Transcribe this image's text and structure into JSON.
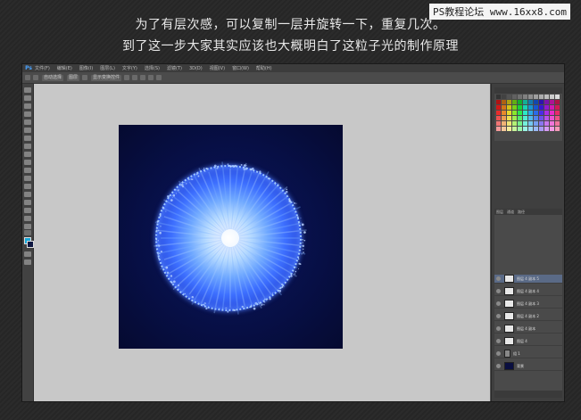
{
  "caption": {
    "line1": "为了有层次感，可以复制一层并旋转一下，重复几次。",
    "line2": "到了这一步大家其实应该也大概明白了这粒子光的制作原理"
  },
  "watermark": "PS教程论坛 www.16xx8.com",
  "photoshop": {
    "logo": "Ps",
    "menu": [
      "文件(F)",
      "编辑(E)",
      "图像(I)",
      "图层(L)",
      "文字(Y)",
      "选择(S)",
      "滤镜(T)",
      "3D(D)",
      "视图(V)",
      "窗口(W)",
      "帮助(H)"
    ],
    "options_bar": [
      "自动选择",
      "图层",
      "显示变换控件"
    ],
    "colors": {
      "foreground": "#19a7d8",
      "background": "#0d1640"
    },
    "layers_tabs": [
      "图层",
      "通道",
      "路径"
    ],
    "layers": [
      {
        "name": "图层 4 副本 5",
        "thumb": "light",
        "active": true
      },
      {
        "name": "图层 4 副本 4",
        "thumb": "light",
        "active": false
      },
      {
        "name": "图层 4 副本 3",
        "thumb": "light",
        "active": false
      },
      {
        "name": "图层 4 副本 2",
        "thumb": "light",
        "active": false
      },
      {
        "name": "图层 4 副本",
        "thumb": "light",
        "active": false
      },
      {
        "name": "图层 4",
        "thumb": "light",
        "active": false
      },
      {
        "name": "组 1",
        "thumb": "group",
        "active": false
      },
      {
        "name": "背景",
        "thumb": "dark",
        "active": false
      }
    ]
  }
}
